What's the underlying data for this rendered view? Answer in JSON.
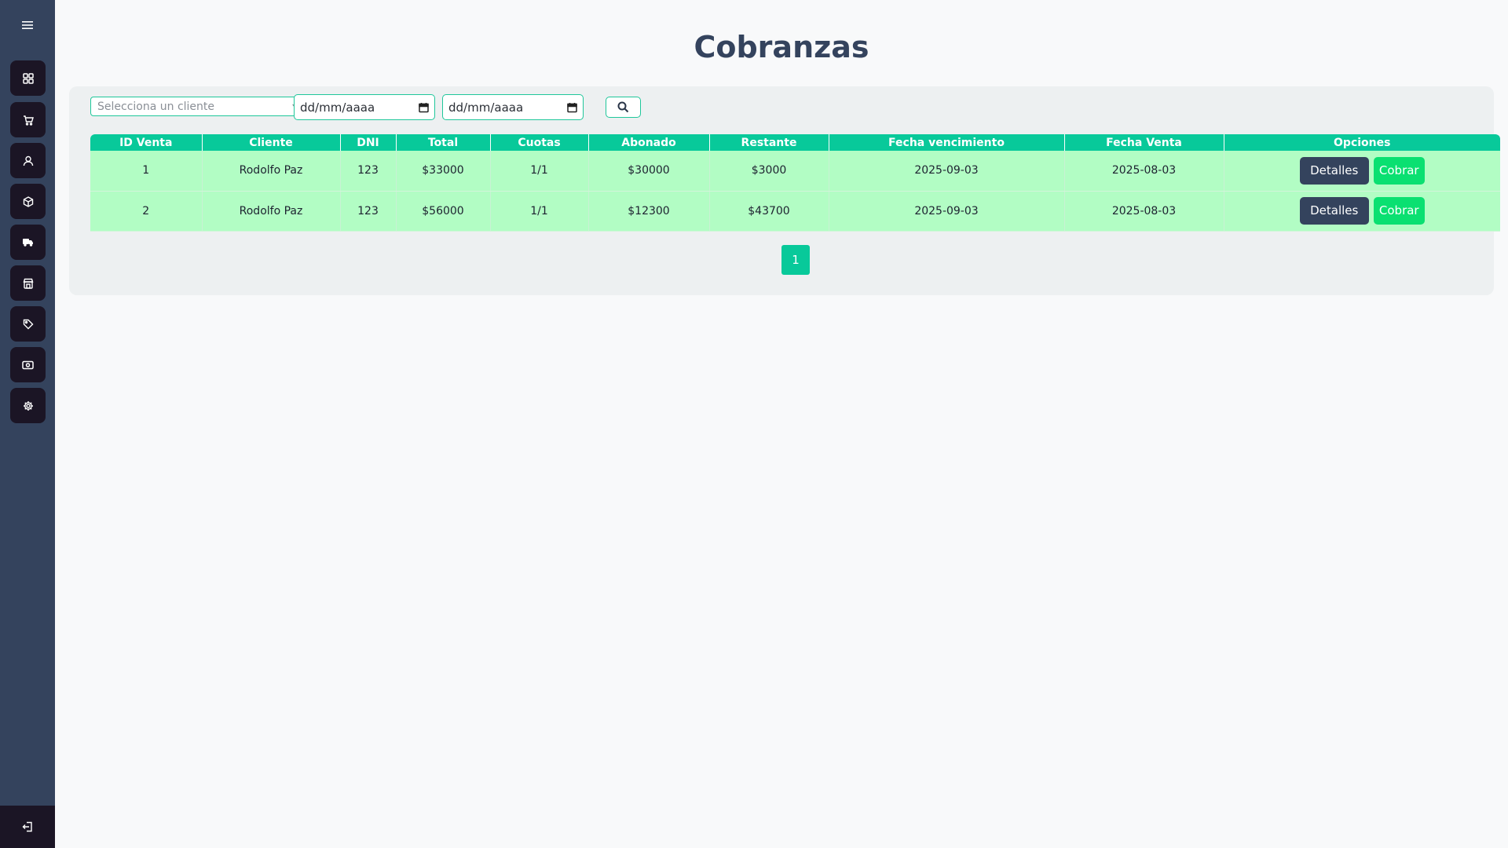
{
  "sidebar": {
    "toggle_icon": "menu-icon",
    "items": [
      {
        "name": "dashboard",
        "icon": "grid-icon"
      },
      {
        "name": "sales",
        "icon": "cart-icon"
      },
      {
        "name": "clients",
        "icon": "user-icon"
      },
      {
        "name": "products",
        "icon": "box-icon"
      },
      {
        "name": "suppliers",
        "icon": "truck-icon"
      },
      {
        "name": "store",
        "icon": "store-icon"
      },
      {
        "name": "tags",
        "icon": "tag-icon"
      },
      {
        "name": "collections",
        "icon": "cash-icon"
      },
      {
        "name": "settings",
        "icon": "gear-icon"
      }
    ],
    "logout_icon": "logout-icon"
  },
  "page": {
    "title": "Cobranzas"
  },
  "filters": {
    "client_placeholder": "Selecciona un cliente",
    "date_from": "dd/mm/aaaa",
    "date_to": "dd/mm/aaaa",
    "search_icon": "search-icon"
  },
  "table": {
    "headers": [
      "ID Venta",
      "Cliente",
      "DNI",
      "Total",
      "Cuotas",
      "Abonado",
      "Restante",
      "Fecha vencimiento",
      "Fecha Venta",
      "Opciones"
    ],
    "rows": [
      {
        "id": "1",
        "cliente": "Rodolfo Paz",
        "dni": "123",
        "total": "$33000",
        "cuotas": "1/1",
        "abonado": "$30000",
        "restante": "$3000",
        "vencimiento": "2025-09-03",
        "fecha_venta": "2025-08-03"
      },
      {
        "id": "2",
        "cliente": "Rodolfo Paz",
        "dni": "123",
        "total": "$56000",
        "cuotas": "1/1",
        "abonado": "$12300",
        "restante": "$43700",
        "vencimiento": "2025-09-03",
        "fecha_venta": "2025-08-03"
      }
    ],
    "detail_label": "Detalles",
    "charge_label": "Cobrar"
  },
  "pagination": {
    "current": "1"
  },
  "colors": {
    "sidebar": "#34435d",
    "nav_button": "#1b1525",
    "table_header": "#08c99a",
    "row_bg": "#b2fdc4",
    "detail_button": "#34435d",
    "charge_button": "#0ae071"
  }
}
